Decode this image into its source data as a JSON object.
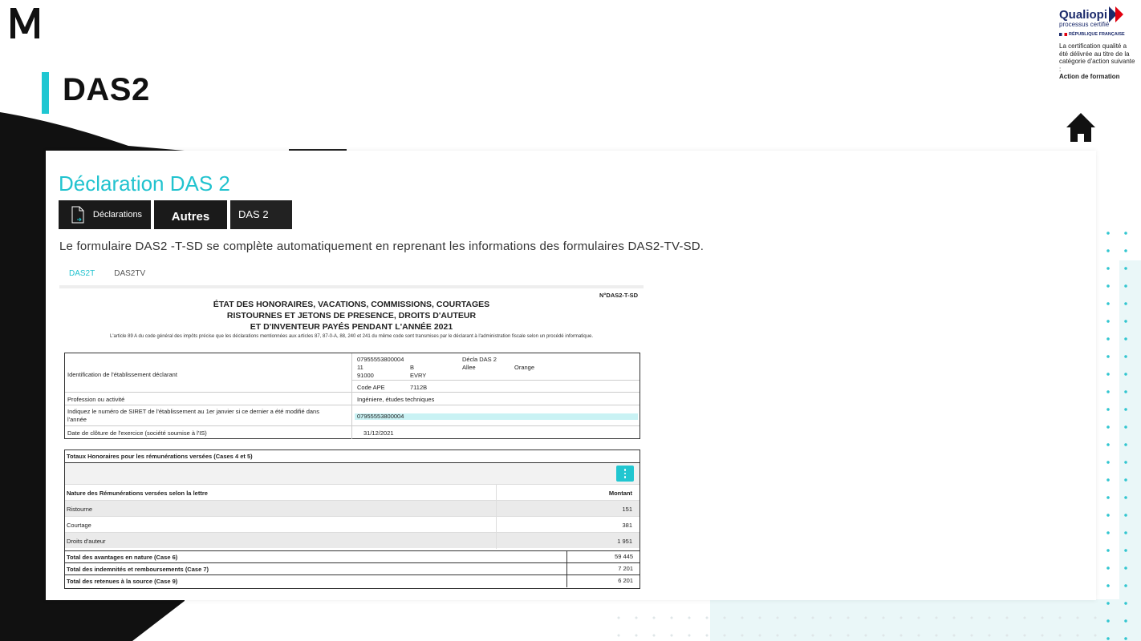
{
  "brand": {
    "logo": "M-logo",
    "page_title": "DAS2"
  },
  "qualiopi": {
    "name": "Qualiopi",
    "subtitle": "processus certifié",
    "republic": "RÉPUBLIQUE FRANÇAISE",
    "text": "La certification qualité a été délivrée au titre de la catégorie d'action suivante :",
    "category": "Action de formation"
  },
  "home": {
    "icon": "home-icon"
  },
  "card": {
    "heading": "Déclaration DAS 2",
    "buttons": {
      "declarations": "Déclarations",
      "autres": "Autres",
      "das2": "DAS 2"
    },
    "description": "Le formulaire DAS2 -T-SD se complète automatiquement en reprenant les informations des formulaires  DAS2-TV-SD.",
    "tabs": [
      {
        "label": "DAS2T",
        "active": true
      },
      {
        "label": "DAS2TV",
        "active": false
      }
    ]
  },
  "form": {
    "number": "N°DAS2-T-SD",
    "title_lines": [
      "ÉTAT DES HONORAIRES, VACATIONS, COMMISSIONS, COURTAGES",
      "RISTOURNES ET JETONS DE PRESENCE, DROITS D'AUTEUR",
      "ET D'INVENTEUR PAYÉS PENDANT L'ANNÉE 2021"
    ],
    "note": "L'article 89 A du code général des impôts précise que les déclarations mentionnées aux articles 87, 87-0-A, 88, 240 et 241 du même code sont transmises par le déclarant à l'administration fiscale selon un procédé informatique.",
    "establishment": {
      "label": "Identification de l'établissement déclarant",
      "siret": "07955553800004",
      "name": "Décla DAS 2",
      "street_num": "11",
      "street_suffix": "B",
      "street_type": "Allee",
      "street_name": "Orange",
      "postcode": "91000",
      "city": "EVRY",
      "ape_label": "Code APE",
      "ape": "7112B"
    },
    "profession": {
      "label": "Profession ou activité",
      "value": "Ingéniere, études techniques"
    },
    "siret_change": {
      "label": "Indiquez le numéro de SIRET de l'établissement au 1er janvier si ce dernier a été modifié dans l'année",
      "value": "07955553800004"
    },
    "closing": {
      "label": "Date de clôture de l'exercice (société soumise à l'IS)",
      "value": "31/12/2021"
    },
    "totals_title": "Totaux Honoraires pour les rémunérations versées (Cases 4 et 5)",
    "table": {
      "columns": [
        "Nature des Rémunérations versées selon la lettre",
        "Montant"
      ],
      "rows": [
        {
          "nature": "Ristourne",
          "montant": "151"
        },
        {
          "nature": "Courtage",
          "montant": "381"
        },
        {
          "nature": "Droits d'auteur",
          "montant": "1 951"
        }
      ]
    },
    "totals": [
      {
        "label": "Total des avantages en nature (Case 6)",
        "value": "59 445"
      },
      {
        "label": "Total des indemnités et remboursements (Case 7)",
        "value": "7 201"
      },
      {
        "label": "Total des retenues à la source (Case 9)",
        "value": "6 201"
      }
    ]
  },
  "colors": {
    "accent": "#22c3cf",
    "dark": "#1a1a1a",
    "qualiopi_blue": "#1b2a6b",
    "qualiopi_red": "#e1000f"
  }
}
